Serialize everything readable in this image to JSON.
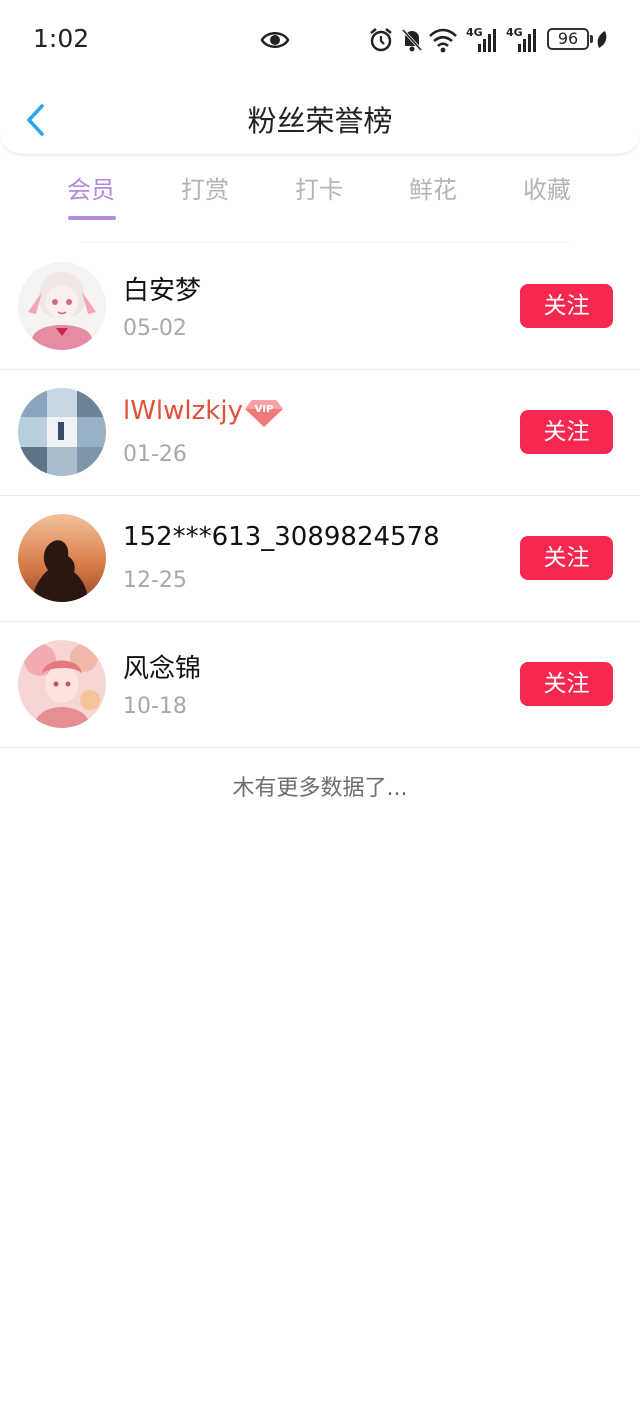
{
  "status_bar": {
    "time": "1:02",
    "net1": "4G",
    "net2": "4G",
    "battery": "96"
  },
  "header": {
    "title": "粉丝荣誉榜"
  },
  "tabs": [
    {
      "label": "会员",
      "active": true
    },
    {
      "label": "打赏",
      "active": false
    },
    {
      "label": "打卡",
      "active": false
    },
    {
      "label": "鲜花",
      "active": false
    },
    {
      "label": "收藏",
      "active": false
    }
  ],
  "fans": [
    {
      "name": "白安梦",
      "date": "05-02",
      "follow_label": "关注",
      "vip": false
    },
    {
      "name": "lWlwlzkjy",
      "date": "01-26",
      "follow_label": "关注",
      "vip": true,
      "vip_badge": "VIP"
    },
    {
      "name": "152***613_3089824578",
      "date": "12-25",
      "follow_label": "关注",
      "vip": false
    },
    {
      "name": "风念锦",
      "date": "10-18",
      "follow_label": "关注",
      "vip": false
    }
  ],
  "footer": {
    "no_more_text": "木有更多数据了..."
  },
  "colors": {
    "accent": "#b18bd9",
    "follow": "#f6284f",
    "vip_name": "#e0513b",
    "back": "#2aa7e8"
  }
}
